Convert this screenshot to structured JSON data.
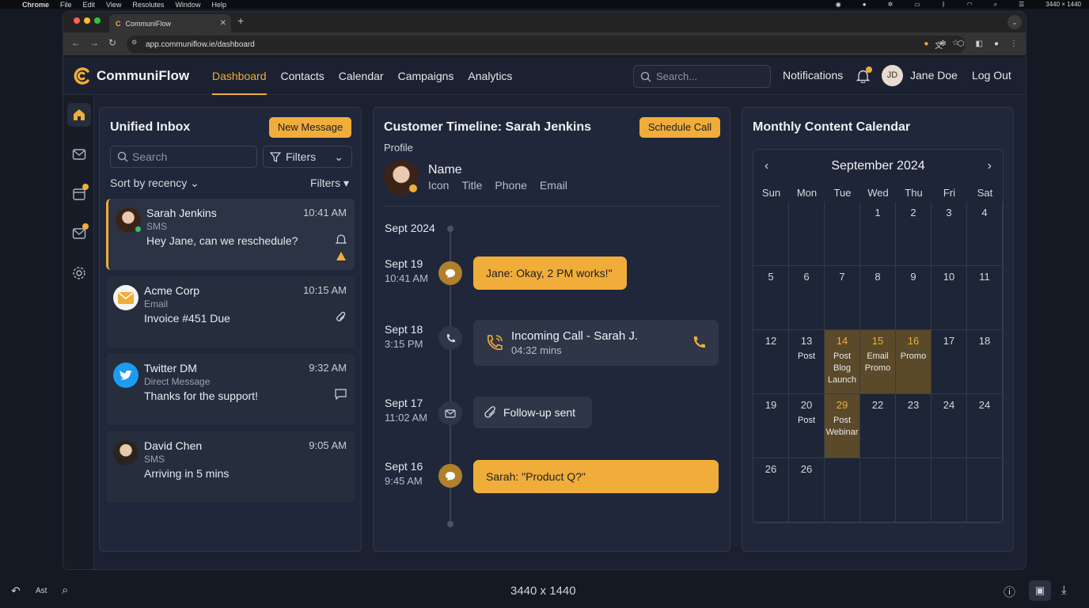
{
  "macos": {
    "apple": "",
    "app": "Chrome",
    "menus": [
      "File",
      "Edit",
      "View",
      "Resolutes",
      "Window",
      "Help"
    ],
    "status_text": "3440 × 1440"
  },
  "browser": {
    "tab_title": "CommuniFlow",
    "url": "app.communiflow.ie/dashboard"
  },
  "app": {
    "name": "CommuniFlow",
    "nav": [
      "Dashboard",
      "Contacts",
      "Calendar",
      "Campaigns",
      "Analytics"
    ],
    "search_placeholder": "Search...",
    "notifications": "Notifications",
    "avatar_initials": "JD",
    "user": "Jane Doe",
    "logout": "Log Out"
  },
  "inbox": {
    "title": "Unified Inbox",
    "new_button": "New Message",
    "search_placeholder": "Search",
    "filters_button": "Filters",
    "sort_label": "Sort by recency",
    "filters_label": "Filters",
    "messages": [
      {
        "name": "Sarah Jenkins",
        "channel": "SMS",
        "preview": "Hey Jane, can we reschedule?",
        "time": "10:41 AM"
      },
      {
        "name": "Acme Corp",
        "channel": "Email",
        "preview": "Invoice #451 Due",
        "time": "10:15 AM"
      },
      {
        "name": "Twitter DM",
        "channel": "Direct Message",
        "preview": "Thanks for the support!",
        "time": "9:32 AM"
      },
      {
        "name": "David Chen",
        "channel": "SMS",
        "preview": "Arriving in 5 mins",
        "time": "9:05 AM"
      }
    ]
  },
  "timeline": {
    "title": "Customer Timeline: Sarah Jenkins",
    "schedule_button": "Schedule Call",
    "profile_label": "Profile",
    "profile_name": "Name",
    "profile_fields": [
      "Icon",
      "Title",
      "Phone",
      "Email"
    ],
    "month": "Sept 2024",
    "events": [
      {
        "date": "Sept 19",
        "time": "10:41 AM",
        "text": "Jane: Okay, 2 PM works!\""
      },
      {
        "date": "Sept 18",
        "time": "3:15 PM",
        "text": "Incoming Call - Sarah J.",
        "sub": "04:32 mins"
      },
      {
        "date": "Sept 17",
        "time": "11:02 AM",
        "text": "Follow-up sent"
      },
      {
        "date": "Sept 16",
        "time": "9:45 AM",
        "text": "Sarah: \"Product Q?\""
      }
    ]
  },
  "calendar": {
    "title": "Monthly Content Calendar",
    "month": "September 2024",
    "dow": [
      "Sun",
      "Mon",
      "Tue",
      "Wed",
      "Thu",
      "Fri",
      "Sat"
    ],
    "weeks": [
      [
        {
          "d": ""
        },
        {
          "d": ""
        },
        {
          "d": ""
        },
        {
          "d": "1"
        },
        {
          "d": "2"
        },
        {
          "d": "3"
        },
        {
          "d": "4"
        }
      ],
      [
        {
          "d": "5"
        },
        {
          "d": "6"
        },
        {
          "d": "7"
        },
        {
          "d": "8"
        },
        {
          "d": "9"
        },
        {
          "d": "10"
        },
        {
          "d": "11"
        }
      ],
      [
        {
          "d": "12"
        },
        {
          "d": "13",
          "ev": "Post"
        },
        {
          "d": "14",
          "ev": "Post Blog Launch",
          "hl": true
        },
        {
          "d": "15",
          "ev": "Email Promo",
          "hl": true
        },
        {
          "d": "16",
          "ev": "Promo",
          "hl": true
        },
        {
          "d": "17"
        },
        {
          "d": "18"
        }
      ],
      [
        {
          "d": "19"
        },
        {
          "d": "20",
          "ev": "Post"
        },
        {
          "d": "29",
          "ev": "Post Webinar",
          "hl": true
        },
        {
          "d": "22"
        },
        {
          "d": "23"
        },
        {
          "d": "24"
        },
        {
          "d": "24"
        }
      ],
      [
        {
          "d": "26"
        },
        {
          "d": "26"
        },
        {
          "d": ""
        },
        {
          "d": ""
        },
        {
          "d": ""
        },
        {
          "d": ""
        },
        {
          "d": ""
        }
      ]
    ]
  },
  "bottom": {
    "left_label": "Ast",
    "center": "3440 x 1440"
  },
  "colors": {
    "accent": "#f0ad3a",
    "bg": "#141923",
    "panel": "#20273a"
  }
}
